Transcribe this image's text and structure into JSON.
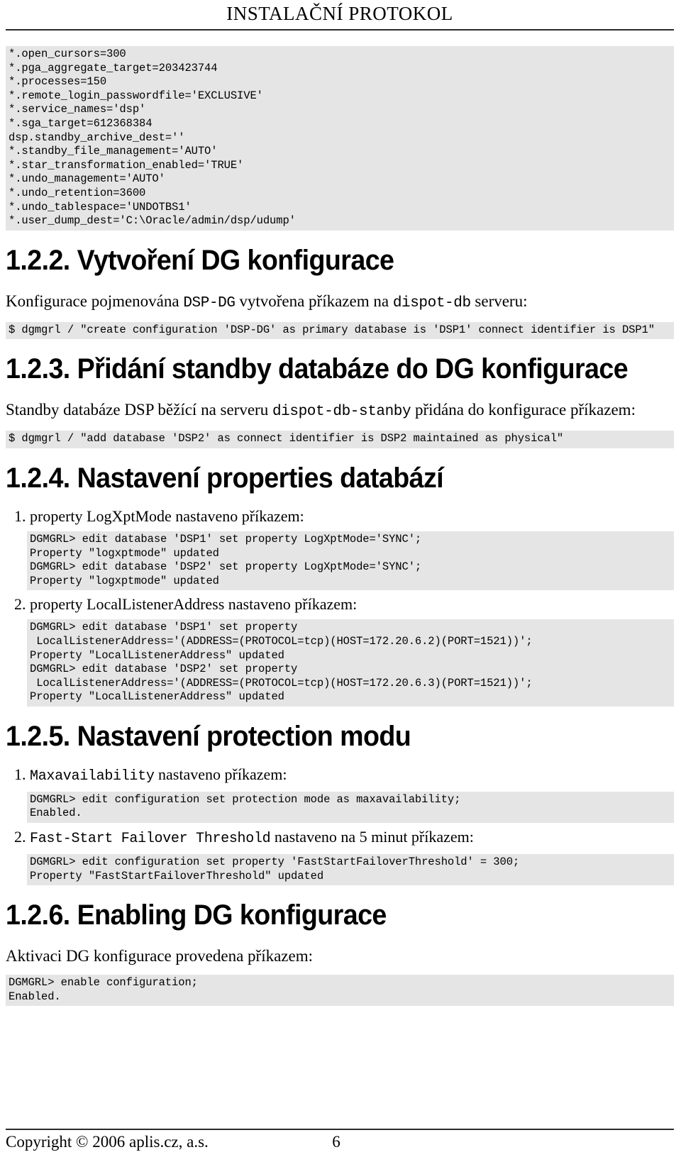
{
  "header": {
    "title": "INSTALAČNÍ PROTOKOL"
  },
  "init_params_code": "*.open_cursors=300\n*.pga_aggregate_target=203423744\n*.processes=150\n*.remote_login_passwordfile='EXCLUSIVE'\n*.service_names='dsp'\n*.sga_target=612368384\ndsp.standby_archive_dest=''\n*.standby_file_management='AUTO'\n*.star_transformation_enabled='TRUE'\n*.undo_management='AUTO'\n*.undo_retention=3600\n*.undo_tablespace='UNDOTBS1'\n*.user_dump_dest='C:\\Oracle/admin/dsp/udump'",
  "sections": {
    "s122": {
      "heading": "1.2.2. Vytvoření DG konfigurace",
      "para_1": "Konfigurace pojmenována ",
      "para_mono_1": "DSP-DG",
      "para_2": " vytvořena příkazem na ",
      "para_mono_2": "dispot-db",
      "para_3": " serveru:",
      "code": "$ dgmgrl / \"create configuration 'DSP-DG' as primary database is 'DSP1' connect identifier is DSP1\""
    },
    "s123": {
      "heading": "1.2.3. Přidání standby databáze do DG konfigurace",
      "para_1": "Standby databáze DSP běžící na serveru ",
      "para_mono_1": "dispot-db-stanby",
      "para_2": " přidána do konfigurace příkazem:",
      "code": "$ dgmgrl / \"add database 'DSP2' as connect identifier is DSP2 maintained as physical\""
    },
    "s124": {
      "heading": "1.2.4. Nastavení properties databází",
      "items": [
        {
          "text_1": "property LogXptMode nastaveno příkazem:",
          "code": "DGMGRL> edit database 'DSP1' set property LogXptMode='SYNC';\nProperty \"logxptmode\" updated\nDGMGRL> edit database 'DSP2' set property LogXptMode='SYNC';\nProperty \"logxptmode\" updated"
        },
        {
          "text_1": "property LocalListenerAddress nastaveno příkazem:",
          "code": "DGMGRL> edit database 'DSP1' set property\n LocalListenerAddress='(ADDRESS=(PROTOCOL=tcp)(HOST=172.20.6.2)(PORT=1521))';\nProperty \"LocalListenerAddress\" updated\nDGMGRL> edit database 'DSP2' set property\n LocalListenerAddress='(ADDRESS=(PROTOCOL=tcp)(HOST=172.20.6.3)(PORT=1521))';\nProperty \"LocalListenerAddress\" updated"
        }
      ]
    },
    "s125": {
      "heading": "1.2.5. Nastavení protection modu",
      "items": [
        {
          "mono_1": "Maxavailability",
          "text_1": " nastaveno příkazem:",
          "code": "DGMGRL> edit configuration set protection mode as maxavailability;\nEnabled."
        },
        {
          "mono_1": "Fast-Start Failover Threshold",
          "text_1": " nastaveno na 5 minut příkazem:",
          "code": "DGMGRL> edit configuration set property 'FastStartFailoverThreshold' = 300;\nProperty \"FastStartFailoverThreshold\" updated"
        }
      ]
    },
    "s126": {
      "heading": "1.2.6. Enabling DG konfigurace",
      "para_1": "Aktivaci DG konfigurace provedena příkazem:",
      "code": "DGMGRL> enable configuration;\nEnabled."
    }
  },
  "footer": {
    "copyright": "Copyright © 2006 aplis.cz, a.s.",
    "page_number": "6"
  }
}
